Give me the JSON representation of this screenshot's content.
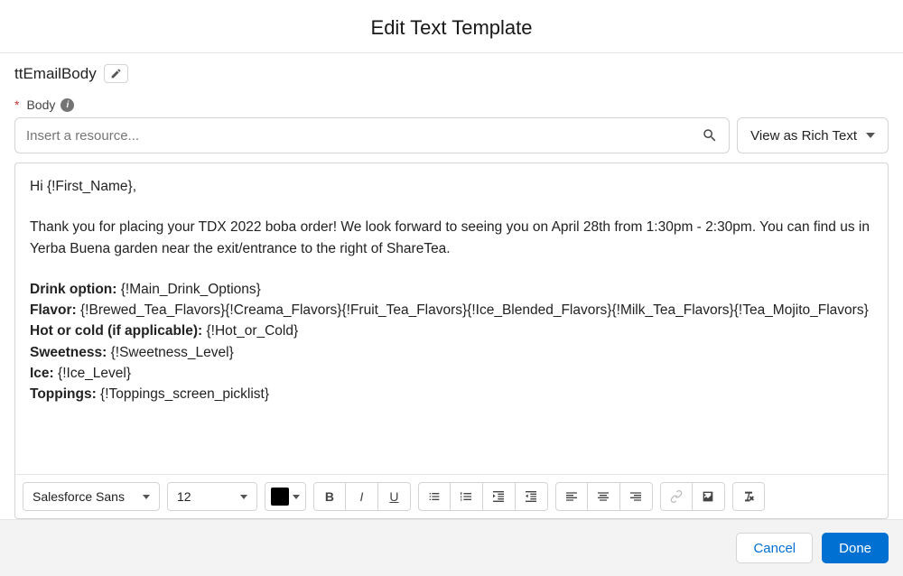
{
  "header": {
    "title": "Edit Text Template"
  },
  "template": {
    "name": "ttEmailBody"
  },
  "body": {
    "label": "Body",
    "resource_placeholder": "Insert a resource...",
    "view_mode": "View as Rich Text",
    "content": {
      "greeting": "Hi {!First_Name},",
      "intro": "Thank you for placing your TDX 2022 boba order! We look forward to seeing you on April 28th from 1:30pm - 2:30pm. You can find us in Yerba Buena garden near the exit/entrance to the right of ShareTea.",
      "drink_label": "Drink option:",
      "drink_value": " {!Main_Drink_Options}",
      "flavor_label": "Flavor:",
      "flavor_value": " {!Brewed_Tea_Flavors}{!Creama_Flavors}{!Fruit_Tea_Flavors}{!Ice_Blended_Flavors}{!Milk_Tea_Flavors}{!Tea_Mojito_Flavors}",
      "hotcold_label": "Hot or cold (if applicable):",
      "hotcold_value": " {!Hot_or_Cold}",
      "sweet_label": "Sweetness:",
      "sweet_value": " {!Sweetness_Level}",
      "ice_label": "Ice:",
      "ice_value": " {!Ice_Level}",
      "toppings_label": "Toppings:",
      "toppings_value": " {!Toppings_screen_picklist}"
    }
  },
  "rte": {
    "font": "Salesforce Sans",
    "size": "12",
    "color": "#000000"
  },
  "footer": {
    "cancel": "Cancel",
    "done": "Done"
  }
}
